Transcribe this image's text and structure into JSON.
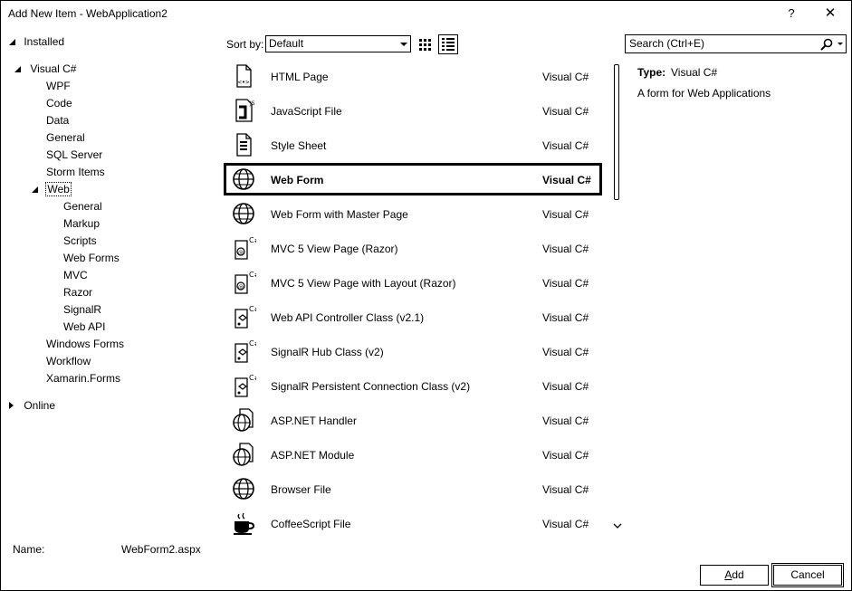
{
  "window": {
    "title": "Add New Item - WebApplication2",
    "help": "?",
    "close": "✕"
  },
  "tree": {
    "installed": "Installed",
    "visual_csharp": "Visual C#",
    "wpf": "WPF",
    "code": "Code",
    "data": "Data",
    "general": "General",
    "sql_server": "SQL Server",
    "storm_items": "Storm Items",
    "web": "Web",
    "web_general": "General",
    "web_markup": "Markup",
    "web_scripts": "Scripts",
    "web_forms": "Web Forms",
    "web_mvc": "MVC",
    "web_razor": "Razor",
    "web_signalr": "SignalR",
    "web_webapi": "Web API",
    "windows_forms": "Windows Forms",
    "workflow": "Workflow",
    "xamarin_forms": "Xamarin.Forms",
    "online": "Online"
  },
  "sortbar": {
    "label": "Sort by:",
    "value": "Default"
  },
  "search": {
    "placeholder": "Search (Ctrl+E)"
  },
  "templates": [
    {
      "name": "HTML Page",
      "lang": "Visual C#",
      "icon": "html-page-icon"
    },
    {
      "name": "JavaScript File",
      "lang": "Visual C#",
      "icon": "javascript-file-icon"
    },
    {
      "name": "Style Sheet",
      "lang": "Visual C#",
      "icon": "style-sheet-icon"
    },
    {
      "name": "Web Form",
      "lang": "Visual C#",
      "icon": "globe-icon",
      "selected": true
    },
    {
      "name": "Web Form with Master Page",
      "lang": "Visual C#",
      "icon": "globe-icon"
    },
    {
      "name": "MVC 5 View Page (Razor)",
      "lang": "Visual C#",
      "icon": "razor-view-icon"
    },
    {
      "name": "MVC 5 View Page with Layout (Razor)",
      "lang": "Visual C#",
      "icon": "razor-view-icon"
    },
    {
      "name": "Web API Controller Class (v2.1)",
      "lang": "Visual C#",
      "icon": "csharp-class-icon"
    },
    {
      "name": "SignalR Hub Class (v2)",
      "lang": "Visual C#",
      "icon": "csharp-class-icon"
    },
    {
      "name": "SignalR Persistent Connection Class (v2)",
      "lang": "Visual C#",
      "icon": "csharp-class-icon"
    },
    {
      "name": "ASP.NET Handler",
      "lang": "Visual C#",
      "icon": "globe-doc-icon"
    },
    {
      "name": "ASP.NET Module",
      "lang": "Visual C#",
      "icon": "globe-doc-icon"
    },
    {
      "name": "Browser File",
      "lang": "Visual C#",
      "icon": "globe-icon"
    },
    {
      "name": "CoffeeScript File",
      "lang": "Visual C#",
      "icon": "coffee-cup-icon"
    }
  ],
  "details": {
    "type_label": "Type:",
    "type_value": "Visual C#",
    "description": "A form for Web Applications"
  },
  "name_field": {
    "label": "Name:",
    "value": "WebForm2.aspx"
  },
  "buttons": {
    "add_prefix": "",
    "add_accel": "A",
    "add_rest": "dd",
    "cancel": "Cancel"
  }
}
